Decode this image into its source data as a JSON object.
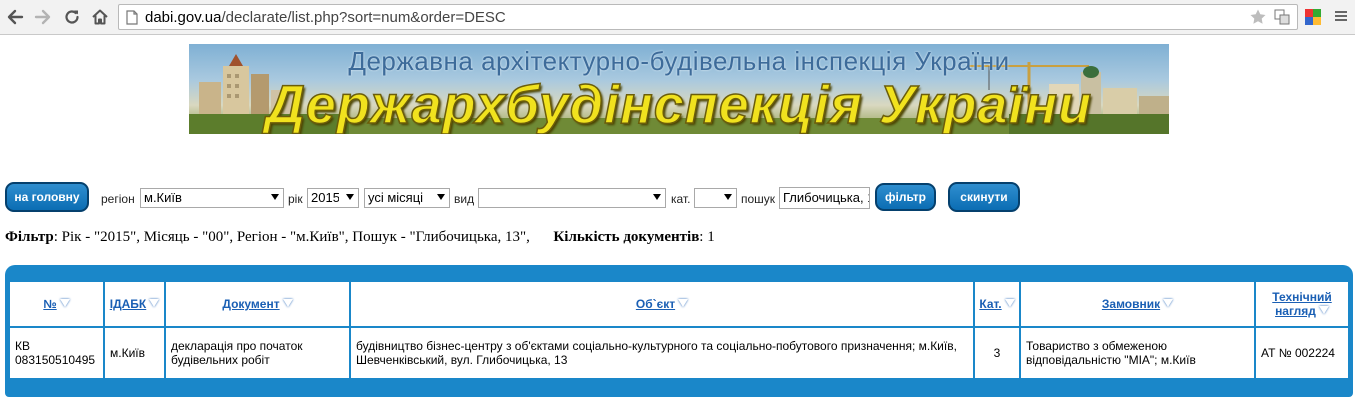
{
  "browser": {
    "url_host": "dabi.gov.ua",
    "url_path": "/declarate/list.php?sort=num&order=DESC"
  },
  "banner": {
    "subtitle": "Державна архітектурно-будівельна інспекція України",
    "title": "Держархбудінспекція України"
  },
  "filter": {
    "home_button": "на головну",
    "region_label": "регіон",
    "region_value": "м.Київ",
    "year_label": "рік",
    "year_value": "2015",
    "month_value": "усі місяці",
    "kind_label": "вид",
    "kind_value": "",
    "category_label": "кат.",
    "category_value": "",
    "search_label": "пошук",
    "search_value": "Глибочицька, 13",
    "filter_button": "фільтр",
    "reset_button": "скинути"
  },
  "summary": {
    "filter_label": "Фільтр",
    "filter_text": ": Рік - \"2015\", Місяць - \"00\", Регіон - \"м.Київ\", Пошук - \"Глибочицька, 13\",",
    "count_label": "Кількість документів",
    "count_value": ": 1"
  },
  "table": {
    "headers": {
      "num": "№",
      "idabk": "ІДАБК",
      "document": "Документ",
      "object": "Об`єкт",
      "category": "Кат.",
      "customer": "Замовник",
      "supervision": "Технічний нагляд"
    },
    "rows": [
      {
        "num": "КВ 083150510495",
        "idabk": "м.Київ",
        "document": "декларація про початок будівельних робіт",
        "object": "будівництво бізнес-центру з об'єктами соціально-культурного та соціально-побутового призначення; м.Київ, Шевченківський, вул. Глибочицька, 13",
        "category": "3",
        "customer": "Товариство з обмеженою відповідальністю \"МІА\"; м.Київ",
        "supervision": "АТ № 002224"
      }
    ]
  },
  "colors": {
    "table_blue": "#1a87c9",
    "button_blue": "#0b6db3",
    "link_blue": "#1a5fb4",
    "banner_title_yellow": "#f1e21e"
  },
  "icons": [
    "back-arrow-icon",
    "forward-arrow-icon",
    "reload-icon",
    "home-icon",
    "page-icon",
    "star-icon",
    "translate-icon",
    "extension-icon",
    "menu-icon",
    "sort-triangle-icon"
  ]
}
